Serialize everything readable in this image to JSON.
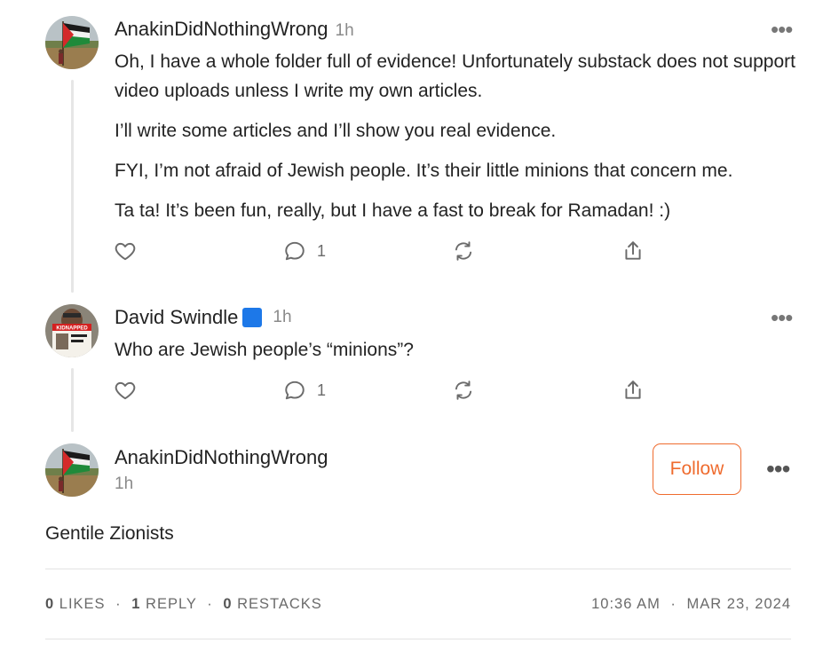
{
  "comments": [
    {
      "author": "AnakinDidNothingWrong",
      "time": "1h",
      "paragraphs": [
        "Oh, I have a whole folder full of evidence! Unfortunately substack does not support video uploads unless I write my own articles.",
        "I’ll write some articles and I’ll show you real evidence.",
        "FYI, I’m not afraid of Jewish people. It’s their little minions that concern me.",
        "Ta ta! It’s been fun, really, but I have a fast to break for Ramadan! :)"
      ],
      "reply_count": "1",
      "menu_label": "•••"
    },
    {
      "author": "David Swindle",
      "time": "1h",
      "text": "Who are Jewish people’s “minions”?",
      "reply_count": "1",
      "menu_label": "•••",
      "avatar_sign_text": "KIDNAPPED"
    }
  ],
  "focused": {
    "author": "AnakinDidNothingWrong",
    "time": "1h",
    "follow_label": "Follow",
    "menu_label": "•••",
    "body": "Gentile Zionists",
    "stats": {
      "likes_count": "0",
      "likes_label": "LIKES",
      "replies_count": "1",
      "replies_label": "REPLY",
      "restacks_count": "0",
      "restacks_label": "RESTACKS",
      "separator": "·",
      "time": "10:36 AM",
      "date": "MAR 23, 2024"
    }
  },
  "colors": {
    "accent": "#ef6b2e",
    "badge_blue": "#1d78e8",
    "muted": "#8a8a8a"
  },
  "icons": [
    "heart-icon",
    "comment-icon",
    "restack-icon",
    "share-icon",
    "more-icon",
    "blue-square-icon"
  ]
}
